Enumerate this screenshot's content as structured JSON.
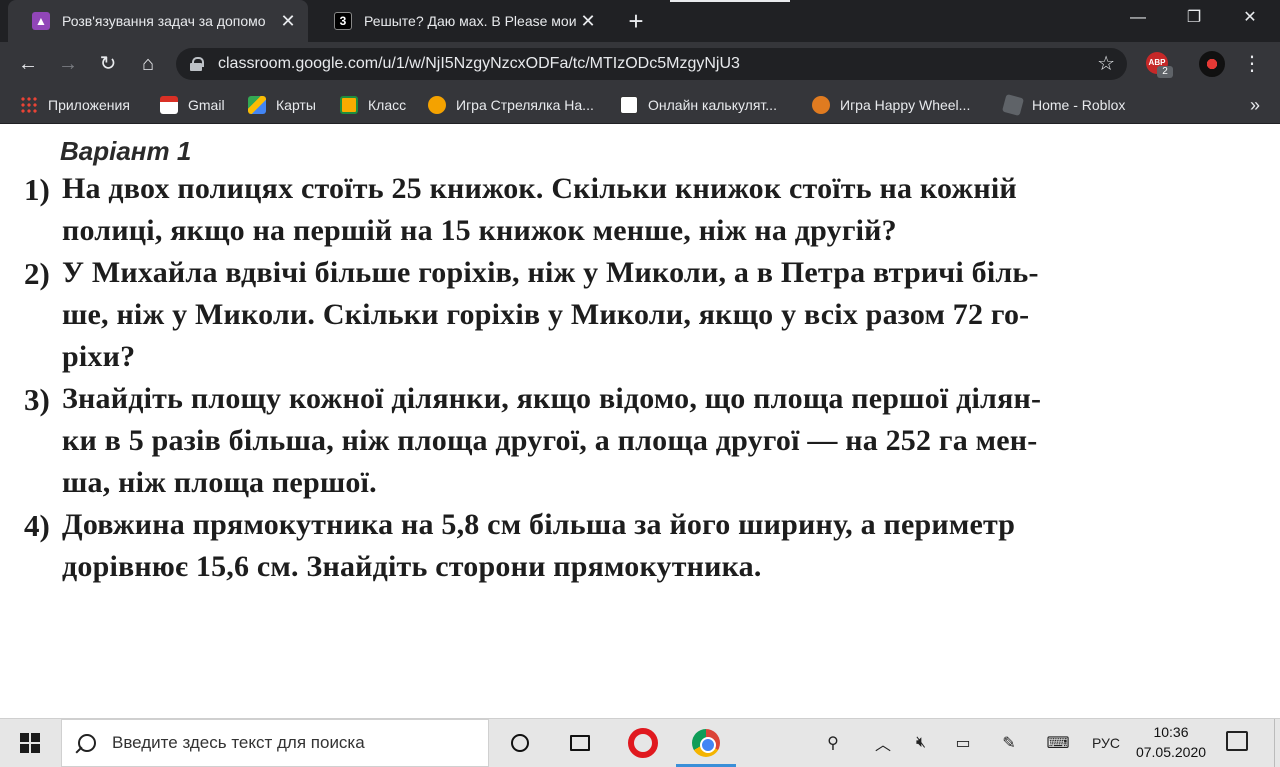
{
  "browser": {
    "tabs": [
      {
        "title": "Розв'язування задач за допомо",
        "active": true
      },
      {
        "title": "Решыте? Даю мах. В Please мои",
        "active": false
      }
    ],
    "address": "classroom.google.com/u/1/w/NjI5NzgyNzcxODFa/tc/MTIzODc5MzgyNjU3",
    "extension_badge": "2",
    "abp_label": "ABP"
  },
  "bookmarks": [
    {
      "label": "Приложения",
      "icon": "apps-grid-icon"
    },
    {
      "label": "Gmail",
      "icon": "gmail-icon"
    },
    {
      "label": "Карты",
      "icon": "maps-icon"
    },
    {
      "label": "Класс",
      "icon": "classroom-icon"
    },
    {
      "label": "Игра Стрелялка На...",
      "icon": "game-icon"
    },
    {
      "label": "Онлайн калькулят...",
      "icon": "calculator-icon"
    },
    {
      "label": "Игра Happy Wheel...",
      "icon": "gear-game-icon"
    },
    {
      "label": "Home - Roblox",
      "icon": "roblox-icon"
    }
  ],
  "document": {
    "variant": "Варіант 1",
    "tasks": [
      {
        "num": "1)",
        "lines": [
          "На двох полицях стоїть 25 книжок. Скільки книжок стоїть на кожній",
          "полиці, якщо на першій на 15 книжок менше, ніж на другій?"
        ]
      },
      {
        "num": "2)",
        "lines": [
          "У Михайла вдвічі більше горіхів, ніж у Миколи, а в Петра втричі біль-",
          "ше, ніж у Миколи. Скільки горіхів у Миколи, якщо у всіх разом 72 го-",
          "ріхи?"
        ]
      },
      {
        "num": "3)",
        "lines": [
          "Знайдіть площу кожної ділянки, якщо відомо, що площа першої ділян-",
          "ки в 5 разів більша, ніж площа другої, а площа другої — на 252 га мен-",
          "ша, ніж площа першої."
        ]
      },
      {
        "num": "4)",
        "lines": [
          "Довжина прямокутника на 5,8 см більша за його ширину, а периметр",
          "дорівнює 15,6 см. Знайдіть сторони прямокутника."
        ]
      }
    ]
  },
  "taskbar": {
    "search_placeholder": "Введите здесь текст для поиска",
    "language": "РУС",
    "time": "10:36",
    "date": "07.05.2020"
  }
}
